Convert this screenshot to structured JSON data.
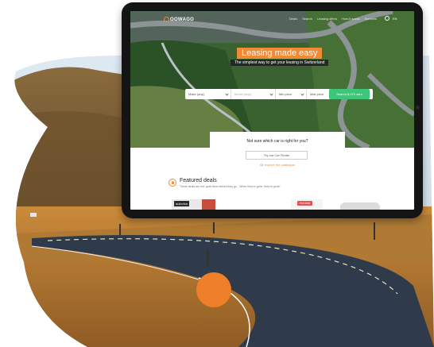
{
  "nav": {
    "logo_text": "OOWAGO",
    "links": [
      "Deals",
      "Search",
      "Leasing offers",
      "How it works",
      "Services"
    ],
    "language": "EN"
  },
  "hero": {
    "headline": "Leasing made easy",
    "subline": "The simplest way to get your leasing in Switzerland"
  },
  "search": {
    "make_label": "Make (any)",
    "model_label": "Model (any)",
    "min_price_label": "Min price",
    "max_price_label": "Max price",
    "button_label": "Search 6,071 cars"
  },
  "finder": {
    "title": "Not sure which car is right for you?",
    "button_label": "Try our Car Finder",
    "or_prefix": "Or",
    "catalogue_link": "explore the catalogue"
  },
  "featured": {
    "title": "Featured deals",
    "subtitle": "These deals are hot, grab them before they go - When they're gone, they're gone!",
    "card1_brand": "autoviva",
    "card2_badge": "Hot deal"
  },
  "colors": {
    "accent": "#f08a34",
    "search_button": "#3fc57a",
    "orange_dot": "#f07f2a"
  }
}
